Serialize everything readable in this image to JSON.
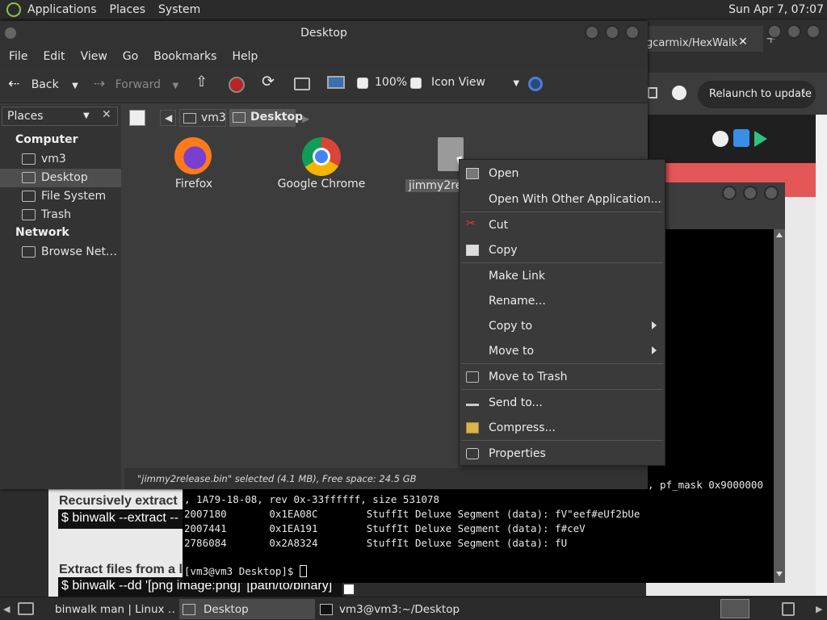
{
  "top_panel": {
    "menus": [
      "Applications",
      "Places",
      "System"
    ],
    "clock": "Sun Apr  7, 07:07"
  },
  "browser": {
    "tab_title": "gcarmix/HexWalk",
    "relaunch_label": "Relaunch to update"
  },
  "webpage": {
    "heading1": "Recursively extract",
    "code1": "$ binwalk --extract --",
    "heading2": "Extract files from a l",
    "code2": "$ binwalk --dd '[png image:png]' [path/to/binary]"
  },
  "terminal": {
    "lines": [
      ", 1A79-18-08, rev 0x-33ffffff, size 531078",
      "2007180       0x1EA08C        StuffIt Deluxe Segment (data): fV\"eef#eUf2bUe",
      "2007441       0x1EA191        StuffIt Deluxe Segment (data): f#ceV",
      "2786084       0x2A8324        StuffIt Deluxe Segment (data): fU"
    ],
    "partial_line": ", pf_mask 0x9000000",
    "prompt": "[vm3@vm3 Desktop]$ "
  },
  "file_manager": {
    "title": "Desktop",
    "menus": [
      "File",
      "Edit",
      "View",
      "Go",
      "Bookmarks",
      "Help"
    ],
    "toolbar": {
      "back": "Back",
      "forward": "Forward",
      "zoom": "100%",
      "view_mode": "Icon View"
    },
    "sidebar": {
      "header": "Places",
      "sections": [
        {
          "title": "Computer",
          "items": [
            "vm3",
            "Desktop",
            "File System",
            "Trash"
          ]
        },
        {
          "title": "Network",
          "items": [
            "Browse Net…"
          ]
        }
      ],
      "selected": "Desktop"
    },
    "breadcrumbs": [
      "vm3",
      "Desktop"
    ],
    "icons": [
      {
        "label": "Firefox"
      },
      {
        "label": "Google Chrome"
      },
      {
        "label": "jimmy2rele"
      }
    ],
    "status": "\"jimmy2release.bin\" selected (4.1 MB), Free space: 24.5 GB"
  },
  "context_menu": {
    "items": [
      {
        "label": "Open",
        "icon": "open-icon"
      },
      {
        "label": "Open With Other Application..."
      },
      {
        "label": "Cut",
        "icon": "scissors-icon"
      },
      {
        "label": "Copy",
        "icon": "copy-icon"
      },
      {
        "label": "Make Link"
      },
      {
        "label": "Rename..."
      },
      {
        "label": "Copy to",
        "submenu": true
      },
      {
        "label": "Move to",
        "submenu": true
      },
      {
        "label": "Move to Trash",
        "icon": "trash-icon"
      },
      {
        "label": "Send to...",
        "icon": "send-icon"
      },
      {
        "label": "Compress...",
        "icon": "archive-icon"
      },
      {
        "label": "Properties",
        "icon": "properties-icon"
      }
    ]
  },
  "taskbar": {
    "tasks": [
      "binwalk man | Linux …",
      "Desktop",
      "vm3@vm3:~/Desktop"
    ]
  },
  "colors": {
    "panel": "#2b2b2b",
    "window": "#3c3c3c",
    "accent_red": "#e45757"
  }
}
